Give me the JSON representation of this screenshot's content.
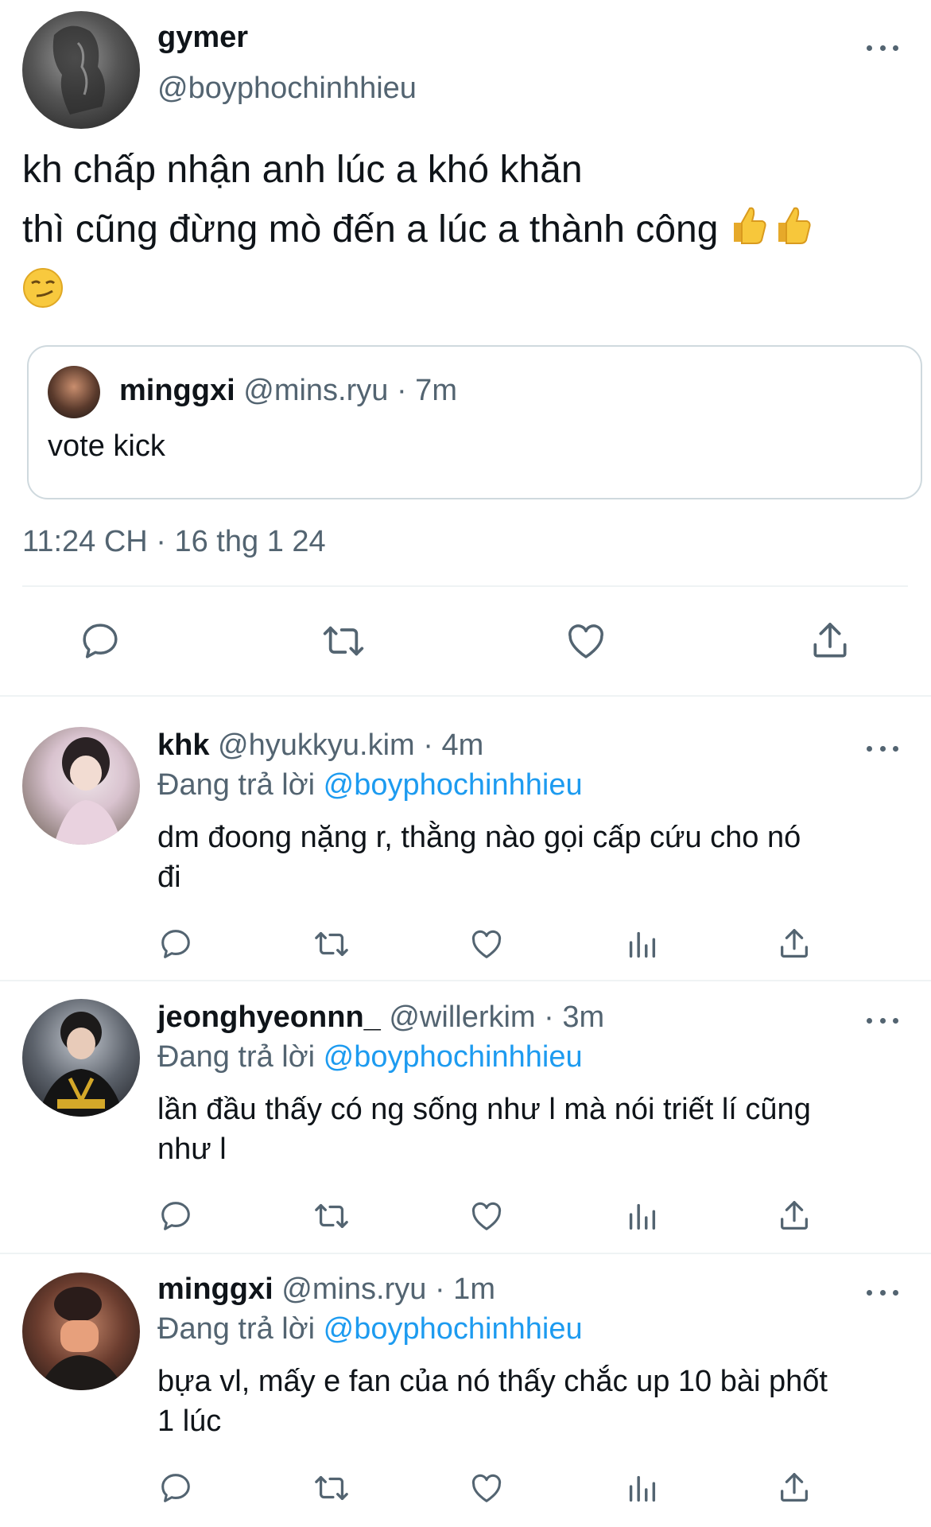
{
  "main_tweet": {
    "display_name": "gymer",
    "handle": "@boyphochinhhieu",
    "text_line1": "kh chấp nhận anh lúc a khó khăn",
    "text_line2": "thì cũng đừng mò đến a lúc a thành công",
    "emoji_line2": [
      "thumbs-up",
      "thumbs-up"
    ],
    "emoji_line3": "smirking-face",
    "quote": {
      "display_name": "minggxi",
      "handle": "@mins.ryu",
      "time": "· 7m",
      "text": "vote kick"
    },
    "timestamp": "11:24 CH · 16 thg 1 24"
  },
  "replying_label": "Đang trả lời",
  "replies": [
    {
      "display_name": "khk",
      "handle": "@hyukkyu.kim",
      "time": "· 4m",
      "reply_to": "@boyphochinhhieu",
      "text_line1": "dm đoong nặng r, thằng nào gọi cấp cứu cho nó",
      "text_line2": "đi"
    },
    {
      "display_name": "jeonghyeonnn_",
      "handle": "@willerkim",
      "time": "· 3m",
      "reply_to": "@boyphochinhhieu",
      "text_line1": "lần đầu thấy có ng sống như l mà nói triết lí cũng",
      "text_line2": "như l"
    },
    {
      "display_name": "minggxi",
      "handle": "@mins.ryu",
      "time": "· 1m",
      "reply_to": "@boyphochinhhieu",
      "text_line1": "bựa vl, mấy e fan của nó thấy chắc up 10 bài phốt",
      "text_line2": "1 lúc"
    }
  ],
  "colors": {
    "text": "#0f1419",
    "muted": "#536471",
    "link": "#1d9bf0",
    "divider": "#eff3f4"
  }
}
